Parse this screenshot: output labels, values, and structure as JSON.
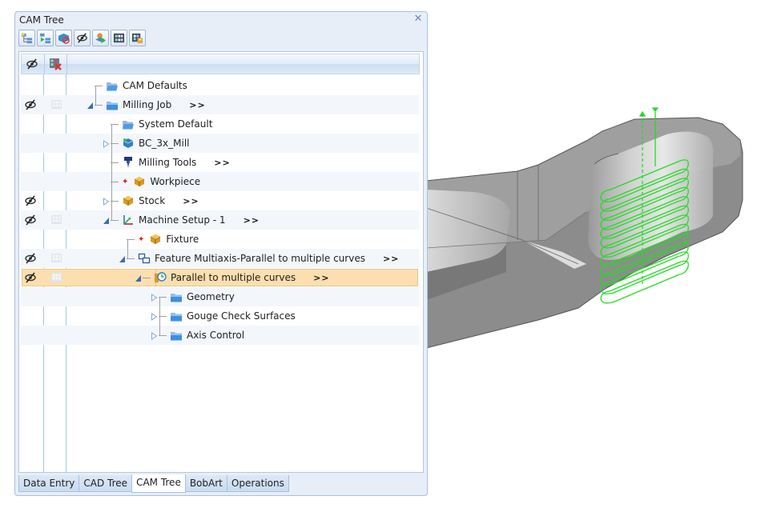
{
  "panel": {
    "title": "CAM Tree",
    "close_icon": "close-icon"
  },
  "toolbar": {
    "buttons": [
      {
        "name": "new-job-button",
        "icon": "tree-new-icon"
      },
      {
        "name": "add-node-button",
        "icon": "tree-add-icon"
      },
      {
        "name": "hide-stock-button",
        "icon": "stock-hide-icon"
      },
      {
        "name": "toggle-visibility-button",
        "icon": "eye-hidden-icon"
      },
      {
        "name": "simulate-button",
        "icon": "simulate-play-icon"
      },
      {
        "name": "grid-view-button",
        "icon": "grid-icon"
      },
      {
        "name": "grid-export-button",
        "icon": "grid-save-icon"
      }
    ]
  },
  "tree_header": {
    "visibility_column_icon": "eye-hidden-icon",
    "grid_column_icon": "grid-delete-icon"
  },
  "tree": {
    "more_label": ">>",
    "rows": [
      {
        "label": "CAM Defaults",
        "icon": "folder-open-icon",
        "level": 0,
        "eye": false,
        "grid": false,
        "expander": "none",
        "more": false
      },
      {
        "label": "Milling Job",
        "icon": "folder-icon",
        "level": 0,
        "eye": true,
        "grid": true,
        "expander": "expanded",
        "more": true
      },
      {
        "label": "System Default",
        "icon": "folder-open-icon",
        "level": 1,
        "eye": false,
        "grid": false,
        "expander": "none",
        "more": false
      },
      {
        "label": "BC_3x_Mill",
        "icon": "machine-icon",
        "level": 1,
        "eye": false,
        "grid": false,
        "expander": "collapsed",
        "more": false
      },
      {
        "label": "Milling Tools",
        "icon": "tool-icon",
        "level": 1,
        "eye": false,
        "grid": false,
        "expander": "none",
        "more": true
      },
      {
        "label": "Workpiece",
        "icon": "box-icon",
        "level": 1,
        "eye": false,
        "grid": false,
        "expander": "none",
        "more": false,
        "marker": true
      },
      {
        "label": "Stock",
        "icon": "box-icon",
        "level": 1,
        "eye": true,
        "grid": false,
        "expander": "collapsed",
        "more": true
      },
      {
        "label": "Machine Setup - 1",
        "icon": "axes-icon",
        "level": 1,
        "eye": true,
        "grid": true,
        "expander": "expanded",
        "more": true
      },
      {
        "label": "Fixture",
        "icon": "box-icon",
        "level": 2,
        "eye": false,
        "grid": false,
        "expander": "none",
        "more": false,
        "marker": true
      },
      {
        "label": "Feature Multiaxis-Parallel to multiple curves",
        "icon": "feature-icon",
        "level": 2,
        "eye": true,
        "grid": true,
        "expander": "expanded",
        "more": true
      },
      {
        "label": "Parallel to multiple curves",
        "icon": "operation-icon",
        "level": 3,
        "eye": true,
        "grid": true,
        "expander": "expanded",
        "more": true,
        "selected": true
      },
      {
        "label": "Geometry",
        "icon": "folder-icon",
        "level": 4,
        "eye": false,
        "grid": false,
        "expander": "collapsed",
        "more": false
      },
      {
        "label": "Gouge Check Surfaces",
        "icon": "folder-icon",
        "level": 4,
        "eye": false,
        "grid": false,
        "expander": "collapsed",
        "more": false
      },
      {
        "label": "Axis Control",
        "icon": "folder-icon",
        "level": 4,
        "eye": false,
        "grid": false,
        "expander": "collapsed",
        "more": false
      }
    ]
  },
  "tabs": [
    {
      "label": "Data Entry",
      "active": false
    },
    {
      "label": "CAD Tree",
      "active": false
    },
    {
      "label": "CAM Tree",
      "active": true
    },
    {
      "label": "BobArt",
      "active": false
    },
    {
      "label": "Operations",
      "active": false
    }
  ],
  "viewport": {
    "toolpath_color": "#22dd22",
    "model_color": "#8c8c8c"
  }
}
